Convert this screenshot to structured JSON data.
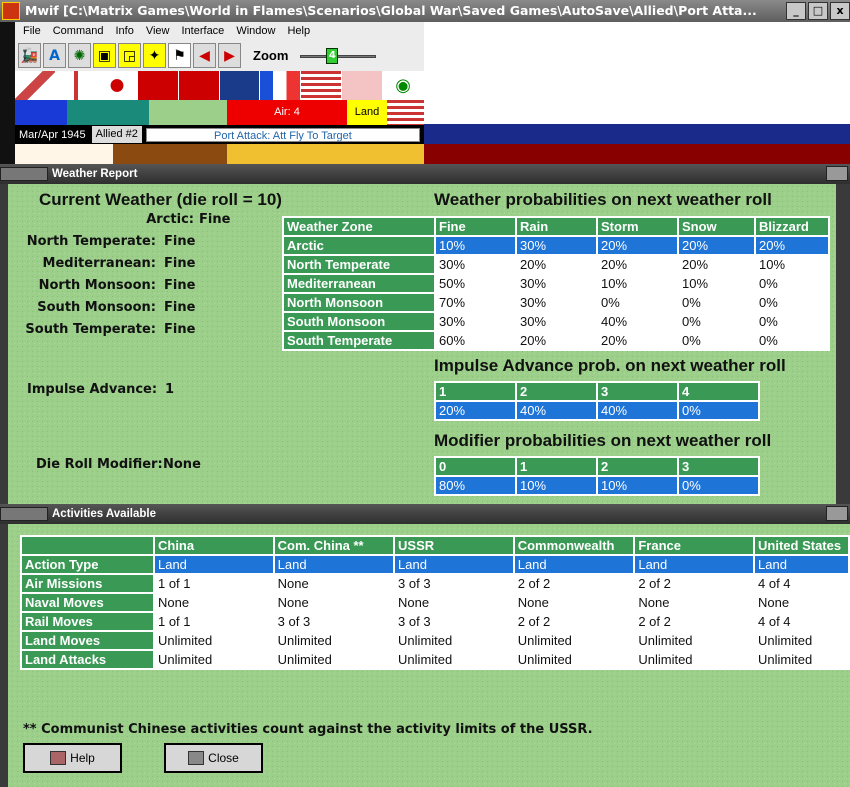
{
  "window": {
    "title": "Mwif [C:\\Matrix Games\\World in Flames\\Scenarios\\Global War\\Saved Games\\AutoSave\\Allied\\Port Atta...",
    "min": "_",
    "max": "□",
    "close": "x"
  },
  "menu": [
    "File",
    "Command",
    "Info",
    "View",
    "Interface",
    "Window",
    "Help"
  ],
  "toolbar": {
    "zoom_label": "Zoom",
    "zoom_value": "4",
    "buttons": [
      "train-icon",
      "text-a-icon",
      "gear-icon",
      "nav-icon",
      "nav2-icon",
      "cursor-icon",
      "flag-icon",
      "arrow-left-icon",
      "arrow-right-icon"
    ]
  },
  "status": {
    "air": "Air: 4",
    "land": "Land",
    "date": "Mar/Apr 1945",
    "side": "Allied #2",
    "action": "Port Attack: Att Fly To Target"
  },
  "weather_report": {
    "panel_title": "Weather Report",
    "current_title": "Current Weather (die roll = 10)",
    "zones": [
      {
        "label": "Arctic:",
        "value": "Fine"
      },
      {
        "label": "North Temperate:",
        "value": "Fine"
      },
      {
        "label": "Mediterranean:",
        "value": "Fine"
      },
      {
        "label": "North Monsoon:",
        "value": "Fine"
      },
      {
        "label": "South Monsoon:",
        "value": "Fine"
      },
      {
        "label": "South Temperate:",
        "value": "Fine"
      }
    ],
    "impulse_label": "Impulse Advance:",
    "impulse_value": "1",
    "modifier_label": "Die Roll Modifier:",
    "modifier_value": "None",
    "prob_title": "Weather probabilities on next weather roll",
    "prob_headers": [
      "Weather Zone",
      "Fine",
      "Rain",
      "Storm",
      "Snow",
      "Blizzard"
    ],
    "prob_rows": [
      [
        "Arctic",
        "10%",
        "30%",
        "20%",
        "20%",
        "20%"
      ],
      [
        "North Temperate",
        "30%",
        "20%",
        "20%",
        "20%",
        "10%"
      ],
      [
        "Mediterranean",
        "50%",
        "30%",
        "10%",
        "10%",
        "0%"
      ],
      [
        "North Monsoon",
        "70%",
        "30%",
        "0%",
        "0%",
        "0%"
      ],
      [
        "South Monsoon",
        "30%",
        "30%",
        "40%",
        "0%",
        "0%"
      ],
      [
        "South Temperate",
        "60%",
        "20%",
        "20%",
        "0%",
        "0%"
      ]
    ],
    "impulse_title": "Impulse Advance prob. on next weather roll",
    "impulse_headers": [
      "1",
      "2",
      "3",
      "4"
    ],
    "impulse_values": [
      "20%",
      "40%",
      "40%",
      "0%"
    ],
    "modifier_title": "Modifier probabilities on next weather roll",
    "modifier_headers": [
      "0",
      "1",
      "2",
      "3"
    ],
    "modifier_values": [
      "80%",
      "10%",
      "10%",
      "0%"
    ]
  },
  "activities": {
    "panel_title": "Activities Available",
    "headers": [
      "",
      "China",
      "Com. China **",
      "USSR",
      "Commonwealth",
      "France",
      "United States"
    ],
    "rows": [
      [
        "Action Type",
        "Land",
        "Land",
        "Land",
        "Land",
        "Land",
        "Land"
      ],
      [
        "Air Missions",
        "1 of 1",
        "None",
        "3 of 3",
        "2 of 2",
        "2 of 2",
        "4 of 4"
      ],
      [
        "Naval Moves",
        "None",
        "None",
        "None",
        "None",
        "None",
        "None"
      ],
      [
        "Rail Moves",
        "1 of 1",
        "3 of 3",
        "3 of 3",
        "2 of 2",
        "2 of 2",
        "4 of 4"
      ],
      [
        "Land Moves",
        "Unlimited",
        "Unlimited",
        "Unlimited",
        "Unlimited",
        "Unlimited",
        "Unlimited"
      ],
      [
        "Land Attacks",
        "Unlimited",
        "Unlimited",
        "Unlimited",
        "Unlimited",
        "Unlimited",
        "Unlimited"
      ]
    ],
    "note": "** Communist Chinese activities count against the activity limits of the USSR.",
    "help_label": "Help",
    "close_label": "Close"
  }
}
